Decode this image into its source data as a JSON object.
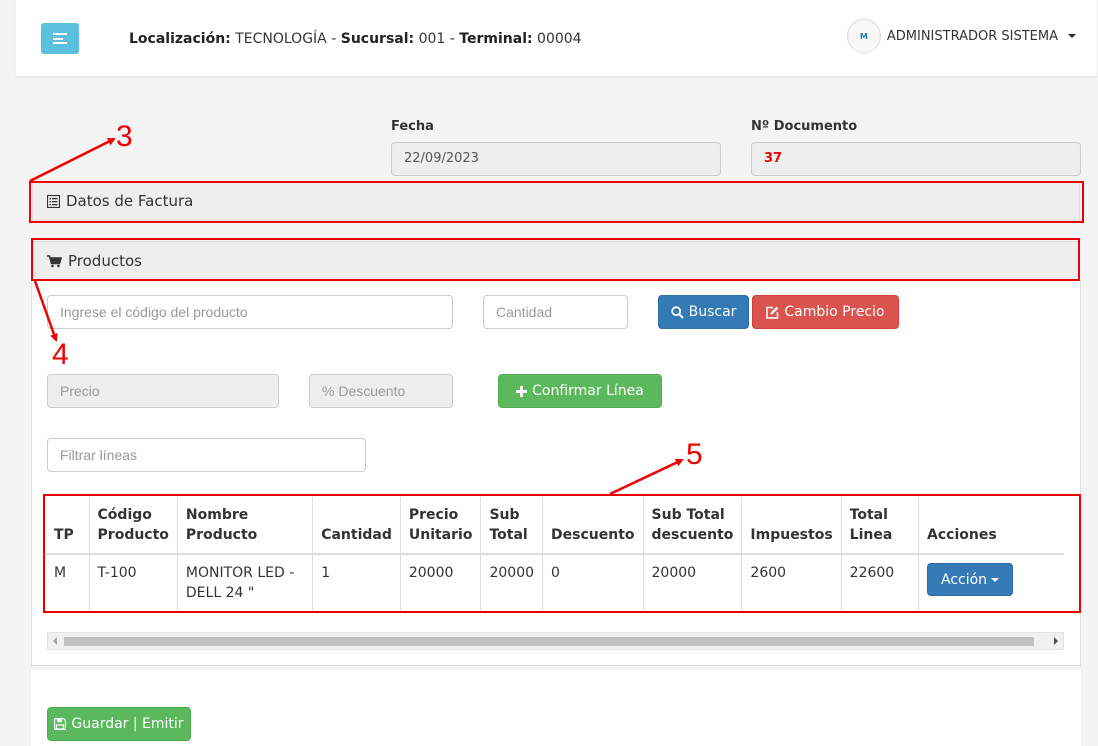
{
  "header": {
    "loc_label": "Localización:",
    "loc_value": "TECNOLOGÍA",
    "sucursal_label": "Sucursal:",
    "sucursal_value": "001",
    "terminal_label": "Terminal:",
    "terminal_value": "00004",
    "separator": "-",
    "avatar_text": "M",
    "user_name": "ADMINISTRADOR SISTEMA"
  },
  "doc": {
    "fecha_label": "Fecha",
    "fecha_value": "22/09/2023",
    "numero_label": "Nº Documento",
    "numero_value": "37"
  },
  "panels": {
    "datos_factura": "Datos de Factura",
    "productos": "Productos"
  },
  "form": {
    "codigo_placeholder": "Ingrese el código del producto",
    "cantidad_placeholder": "Cantidad",
    "buscar_label": "Buscar",
    "cambio_precio_label": "Cambio Precio",
    "precio_placeholder": "Precio",
    "descuento_placeholder": "% Descuento",
    "confirmar_label": "Confirmar Línea",
    "filtrar_placeholder": "Filtrar líneas"
  },
  "table": {
    "columns": [
      "TP",
      "Código Producto",
      "Nombre Producto",
      "Cantidad",
      "Precio Unitario",
      "Sub Total",
      "Descuento",
      "Sub Total descuento",
      "Impuestos",
      "Total Linea",
      "Acciones"
    ],
    "rows": [
      {
        "tp": "M",
        "codigo": "T-100",
        "nombre": "MONITOR LED - DELL 24 \"",
        "cantidad": "1",
        "precio": "20000",
        "subtotal": "20000",
        "descuento": "0",
        "subtotal_desc": "20000",
        "impuestos": "2600",
        "total": "22600",
        "accion_label": "Acción"
      }
    ]
  },
  "footer": {
    "guardar_label": "Guardar | Emitir"
  },
  "annotations": {
    "n3": "3",
    "n4": "4",
    "n5": "5"
  },
  "colors": {
    "annotation": "#e00000",
    "primary": "#337ab7",
    "danger": "#d9534f",
    "success": "#5cb85c",
    "info": "#5bc0de"
  },
  "icons": {
    "menu": "bars-icon",
    "datos_factura": "list-alt-icon",
    "productos": "shopping-cart-icon",
    "buscar": "search-icon",
    "cambio_precio": "edit-icon",
    "confirmar": "plus-icon",
    "guardar": "save-icon"
  }
}
